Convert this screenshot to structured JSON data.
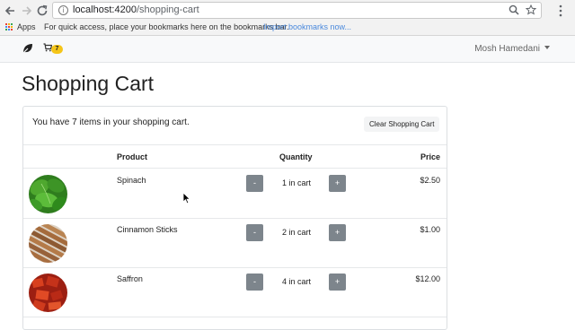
{
  "browser": {
    "url_host": "localhost:4200",
    "url_path": "/shopping-cart",
    "back_icon": "back-arrow-icon",
    "forward_icon": "forward-arrow-icon",
    "reload_icon": "reload-icon",
    "zoom_icon": "magnifier-icon",
    "star_icon": "star-icon",
    "menu_icon": "kebab-menu-icon",
    "bookmarks": {
      "apps_label": "Apps",
      "hint": "For quick access, place your bookmarks here on the bookmarks bar.",
      "import_link": "Import bookmarks now..."
    }
  },
  "navbar": {
    "brand_icon": "leaf-icon",
    "cart_icon": "shopping-cart-icon",
    "cart_count": "7",
    "user_name": "Mosh Hamedani"
  },
  "page": {
    "title": "Shopping Cart",
    "summary": "You have 7 items in your shopping cart.",
    "clear_button": "Clear Shopping Cart",
    "columns": {
      "product": "Product",
      "quantity": "Quantity",
      "price": "Price"
    },
    "items": [
      {
        "name": "Spinach",
        "quantity_text": "1 in cart",
        "price": "$2.50",
        "minus": "-",
        "plus": "+"
      },
      {
        "name": "Cinnamon Sticks",
        "quantity_text": "2 in cart",
        "price": "$1.00",
        "minus": "-",
        "plus": "+"
      },
      {
        "name": "Saffron",
        "quantity_text": "4 in cart",
        "price": "$12.00",
        "minus": "-",
        "plus": "+"
      }
    ]
  },
  "colors": {
    "badge": "#f5c518",
    "link": "#4a89dc",
    "qty_button": "#7d858c"
  }
}
